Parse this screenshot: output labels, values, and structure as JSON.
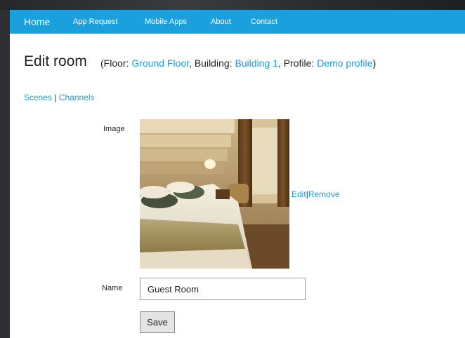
{
  "nav": {
    "items": [
      {
        "label": "Home"
      },
      {
        "label": "App Request"
      },
      {
        "label": "Mobile Apps"
      },
      {
        "label": "About"
      },
      {
        "label": "Contact"
      }
    ]
  },
  "page": {
    "title": "Edit room",
    "subtitle": {
      "open": "(Floor: ",
      "floor": "Ground Floor",
      "building_prefix": ", Building: ",
      "building": "Building 1",
      "profile_prefix": ", Profile: ",
      "profile": "Demo profile",
      "close": ")"
    },
    "links": {
      "scenes": "Scenes",
      "separator": "|",
      "channels": "Channels"
    }
  },
  "form": {
    "image_label": "Image",
    "image_edit": "Edit",
    "image_separator": "|",
    "image_remove": "Remove",
    "name_label": "Name",
    "name_value": "Guest Room",
    "save_label": "Save"
  },
  "colors": {
    "navbar": "#1aa0dd",
    "link": "#1b9fd8",
    "background": "#2f3033"
  }
}
